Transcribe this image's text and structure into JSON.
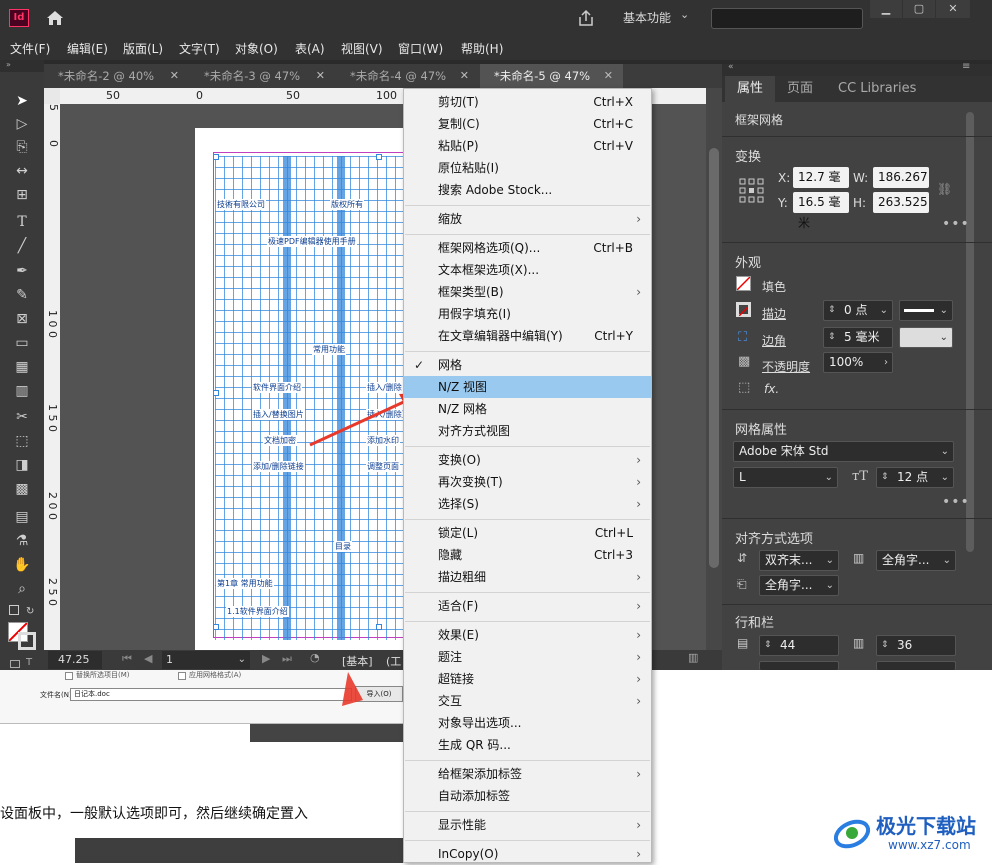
{
  "app": {
    "logo": "Id",
    "workspace": "基本功能",
    "win_min": "▁",
    "win_max": "▢",
    "win_close": "✕"
  },
  "menubar": [
    "文件(F)",
    "编辑(E)",
    "版面(L)",
    "文字(T)",
    "对象(O)",
    "表(A)",
    "视图(V)",
    "窗口(W)",
    "帮助(H)"
  ],
  "tabs": [
    {
      "label": "*未命名-2 @ 40%"
    },
    {
      "label": "*未命名-3 @ 47%"
    },
    {
      "label": "*未命名-4 @ 47%"
    },
    {
      "label": "*未命名-5 @ 47%",
      "active": true
    }
  ],
  "tab_close": "✕",
  "ruler": {
    "top": [
      "50",
      "0",
      "50",
      "100"
    ],
    "left": [
      "5",
      "0",
      "1 0 0",
      "1 5 0",
      "2 0 0",
      "2 5 0"
    ]
  },
  "page_text": {
    "t1": "技術有限公司",
    "t2": "版权所有",
    "t3": "极速PDF编辑器使用手册",
    "t4": "常用功能",
    "t5": "软件界面介绍",
    "t6": "插入/删除",
    "t7": "插入/替换图片",
    "t8": "插入/删除页面",
    "t9": "文档加密",
    "t10": "添加水印",
    "t11": "添加/删除链接",
    "t12": "调整页面",
    "t13": "目录",
    "t14": "第1章 常用功能",
    "t15": "1.1软件界面介绍"
  },
  "status": {
    "zoom": "47.25",
    "page": "1",
    "mode": "[基本]",
    "mode2": "(工"
  },
  "panel": {
    "tabs": [
      "属性",
      "页面",
      "CC Libraries"
    ],
    "object_type": "框架网格",
    "transform": {
      "title": "变换",
      "x_label": "X:",
      "x": "12.7 毫米",
      "y_label": "Y:",
      "y": "16.5 毫米",
      "w_label": "W:",
      "w": "186.267",
      "h_label": "H:",
      "h": "263.525"
    },
    "appearance": {
      "title": "外观",
      "fill": "填色",
      "stroke": "描边",
      "stroke_val": "0 点",
      "corner": "边角",
      "corner_val": "5 毫米",
      "opacity": "不透明度",
      "opacity_val": "100%",
      "fx": "fx."
    },
    "grid": {
      "title": "网格属性",
      "font": "Adobe 宋体 Std",
      "style": "L",
      "size": "12 点"
    },
    "align": {
      "title": "对齐方式选项",
      "a1": "双齐末...",
      "a2": "全角字...",
      "a3": "全角字..."
    },
    "rows": {
      "title": "行和栏",
      "rows": "44",
      "cols": "36"
    }
  },
  "context_menu": [
    {
      "label": "剪切(T)",
      "shortcut": "Ctrl+X"
    },
    {
      "label": "复制(C)",
      "shortcut": "Ctrl+C"
    },
    {
      "label": "粘贴(P)",
      "shortcut": "Ctrl+V"
    },
    {
      "label": "原位粘贴(I)",
      "shortcut": ""
    },
    {
      "label": "搜索 Adobe Stock...",
      "shortcut": ""
    },
    {
      "label": "缩放",
      "submenu": true
    },
    {
      "label": "框架网格选项(Q)...",
      "shortcut": "Ctrl+B"
    },
    {
      "label": "文本框架选项(X)...",
      "shortcut": ""
    },
    {
      "label": "框架类型(B)",
      "submenu": true
    },
    {
      "label": "用假字填充(I)",
      "shortcut": ""
    },
    {
      "label": "在文章编辑器中编辑(Y)",
      "shortcut": "Ctrl+Y"
    },
    {
      "label": "网格",
      "checked": true
    },
    {
      "label": "N/Z 视图",
      "highlighted": true
    },
    {
      "label": "N/Z 网格"
    },
    {
      "label": "对齐方式视图"
    },
    {
      "label": "变换(O)",
      "submenu": true
    },
    {
      "label": "再次变换(T)",
      "submenu": true
    },
    {
      "label": "选择(S)",
      "submenu": true
    },
    {
      "label": "锁定(L)",
      "shortcut": "Ctrl+L"
    },
    {
      "label": "隐藏",
      "shortcut": "Ctrl+3"
    },
    {
      "label": "描边粗细",
      "submenu": true
    },
    {
      "label": "适合(F)",
      "submenu": true
    },
    {
      "label": "效果(E)",
      "submenu": true
    },
    {
      "label": "题注",
      "submenu": true
    },
    {
      "label": "超链接",
      "submenu": true
    },
    {
      "label": "交互",
      "submenu": true
    },
    {
      "label": "对象导出选项..."
    },
    {
      "label": "生成 QR 码..."
    },
    {
      "label": "给框架添加标签",
      "submenu": true
    },
    {
      "label": "自动添加标签"
    },
    {
      "label": "显示性能",
      "submenu": true
    },
    {
      "label": "InCopy(O)",
      "submenu": true
    }
  ],
  "background_doc": {
    "text": "设面板中，一般默认选项即可，然后继续确定置入",
    "filename_label": "文件名(N):",
    "filename": "日记本.doc",
    "opt1": "替换所选项目(M)",
    "opt2": "应用网格格式(A)",
    "btn": "导入(O)"
  },
  "watermark": {
    "brand": "极光下载站",
    "url": "www.xz7.com"
  },
  "colors": {
    "highlight": "#99c9ef",
    "arrow": "#e8392b",
    "grid": "#3387dc"
  }
}
